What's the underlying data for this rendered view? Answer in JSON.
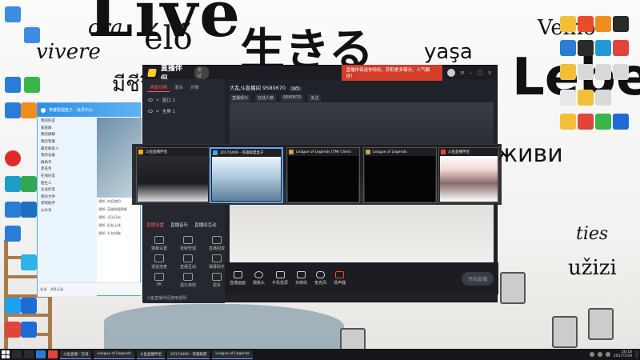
{
  "wallpaper": {
    "words": [
      "Live",
      "élő",
      "生きる",
      "Leben",
      "живи",
      "ora",
      "vivere",
      "Velno",
      "ties",
      "užizi",
      "มีชีวิต",
      "yaşa"
    ]
  },
  "app": {
    "name": "直播伴侣",
    "version": "测试",
    "promo": "直播伴侣送你特权，获取更多曝光，人气翻倍！",
    "left_tabs": [
      "场景切换",
      "混合",
      "对象"
    ],
    "scenes": [
      "窗口 1",
      "全屏 1"
    ],
    "lower_tabs": [
      "直播设置",
      "直播音乐",
      "直播间互动"
    ],
    "tools": [
      "弹幕设置",
      "录制管理",
      "直播回放",
      "语音连麦",
      "直播互动",
      "弹幕助手",
      "PK",
      "送礼特效",
      "更多"
    ],
    "footer_note": "斗鱼直播伴侣使用说明",
    "room": {
      "title": "大乱斗直播间 9580670",
      "level": "LV5",
      "stats": [
        "直播观众",
        "在线人数",
        "9580670",
        "关注"
      ]
    },
    "bottom_bar": [
      "直播画面",
      "摄像头",
      "手机投屏",
      "多媒体",
      "麦克风",
      "扬声器"
    ],
    "start_button": "开始直播"
  },
  "switcher": {
    "items": [
      {
        "label": "斗鱼直播伴侣",
        "color": "#f5a524"
      },
      {
        "label": "20174409 - 英雄联盟盒子",
        "color": "#4aa3e8"
      },
      {
        "label": "League of Legends (TM) Client",
        "color": "#c8a24a"
      },
      {
        "label": "League of Legends",
        "color": "#c8a24a"
      },
      {
        "label": "斗鱼直播伴侣",
        "color": "#e94c2b"
      }
    ]
  },
  "qq": {
    "title": "英雄联盟盒子 - 会员中心",
    "tree": [
      "我的好友",
      "家族群",
      "我的群聊",
      "我的客服",
      "最近联系人",
      "我的设备",
      "群助手",
      "黑名单",
      "在线好友",
      "陌生人",
      "企业好友",
      "我的文件",
      "游戏助手",
      "公众号"
    ],
    "messages": [
      "通知: 欢迎使用",
      "通知: 英雄联盟更新",
      "通知: 活动开启",
      "通知: 好友上线",
      "通知: 礼包领取"
    ],
    "footer": [
      "发送",
      "消息记录"
    ]
  },
  "taskbar": {
    "apps": [
      "斗鱼直播 - 在线",
      "League of Legends",
      "斗鱼直播伴侣",
      "20174409 - 英雄联盟",
      "League of Legends"
    ],
    "clock_time": "20:18",
    "clock_date": "2017/7/29"
  }
}
